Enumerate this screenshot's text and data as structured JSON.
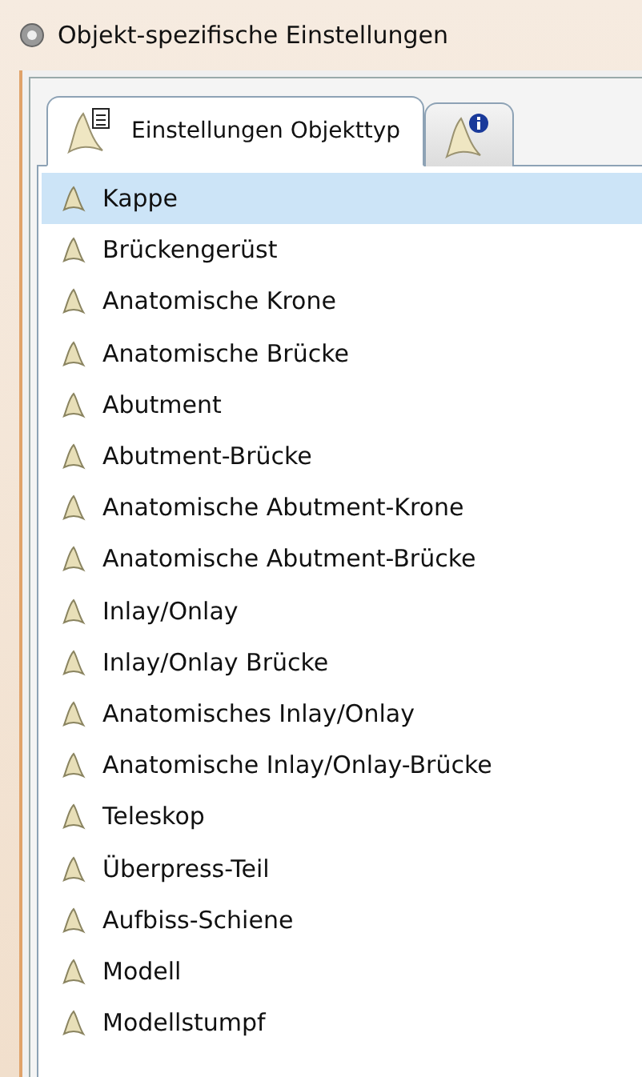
{
  "window": {
    "title": "Objekt-spezifische Einstellungen"
  },
  "tabs": [
    {
      "label": "Einstellungen Objekttyp",
      "selected": true,
      "kind": "settings"
    },
    {
      "selected": false,
      "kind": "info"
    }
  ],
  "items": [
    {
      "label": "Kappe",
      "selected": true
    },
    {
      "label": "Brückengerüst",
      "selected": false
    },
    {
      "label": "Anatomische Krone",
      "selected": false
    },
    {
      "label": "Anatomische Brücke",
      "selected": false
    },
    {
      "label": "Abutment",
      "selected": false
    },
    {
      "label": "Abutment-Brücke",
      "selected": false
    },
    {
      "label": "Anatomische Abutment-Krone",
      "selected": false
    },
    {
      "label": "Anatomische Abutment-Brücke",
      "selected": false
    },
    {
      "label": "Inlay/Onlay",
      "selected": false
    },
    {
      "label": "Inlay/Onlay Brücke",
      "selected": false
    },
    {
      "label": "Anatomisches Inlay/Onlay",
      "selected": false
    },
    {
      "label": "Anatomische Inlay/Onlay-Brücke",
      "selected": false
    },
    {
      "label": "Teleskop",
      "selected": false
    },
    {
      "label": "Überpress-Teil",
      "selected": false
    },
    {
      "label": "Aufbiss-Schiene",
      "selected": false
    },
    {
      "label": "Modell",
      "selected": false
    },
    {
      "label": "Modellstumpf",
      "selected": false
    }
  ]
}
